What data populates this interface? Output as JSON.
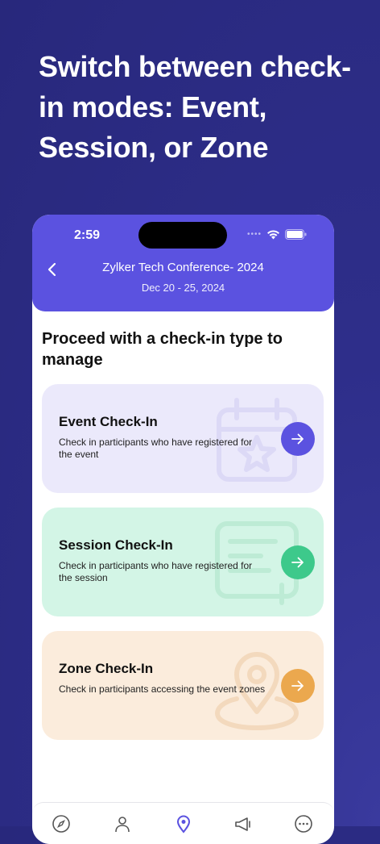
{
  "promo": {
    "title": "Switch between check-in modes: Event, Session, or Zone"
  },
  "status_bar": {
    "time": "2:59"
  },
  "header": {
    "event_name": "Zylker Tech Conference- 2024",
    "event_dates": "Dec 20 - 25, 2024"
  },
  "main": {
    "prompt": "Proceed with a check-in type to manage",
    "cards": [
      {
        "title": "Event Check-In",
        "description": "Check in participants who have registered for the event",
        "icon": "calendar-star-icon",
        "background": "#ebe9fb",
        "accent": "#5b52e0"
      },
      {
        "title": "Session Check-In",
        "description": "Check in participants who have registered for the session",
        "icon": "document-icon",
        "background": "#d3f5e6",
        "accent": "#3dc98b"
      },
      {
        "title": "Zone Check-In",
        "description": "Check in participants accessing the event zones",
        "icon": "map-pin-icon",
        "background": "#fbecdc",
        "accent": "#eba84e"
      }
    ]
  },
  "tab_bar": {
    "items": [
      {
        "icon": "compass-icon"
      },
      {
        "icon": "people-icon"
      },
      {
        "icon": "location-icon",
        "active": true
      },
      {
        "icon": "megaphone-icon"
      },
      {
        "icon": "more-icon"
      }
    ],
    "active_color": "#5b52e0"
  },
  "colors": {
    "header": "#5b52e0",
    "page_background": "#2e2e8a"
  }
}
